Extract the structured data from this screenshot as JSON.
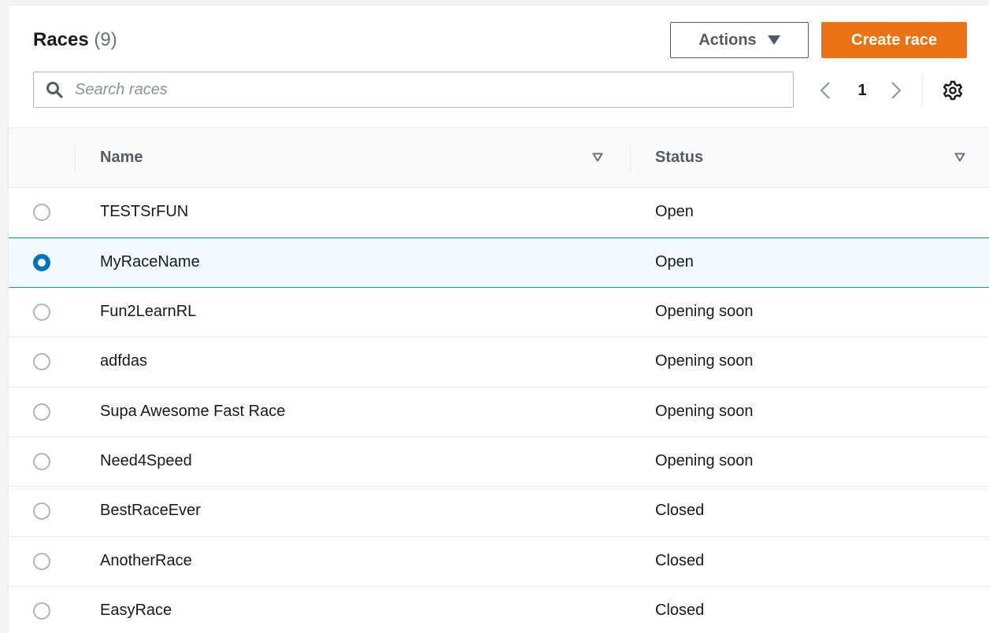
{
  "header": {
    "title": "Races",
    "count": "(9)",
    "actions_label": "Actions",
    "create_label": "Create race"
  },
  "search": {
    "placeholder": "Search races",
    "value": ""
  },
  "pagination": {
    "current_page": "1"
  },
  "table": {
    "columns": [
      "Name",
      "Status"
    ],
    "rows": [
      {
        "name": "TESTSrFUN",
        "status": "Open",
        "selected": false
      },
      {
        "name": "MyRaceName",
        "status": "Open",
        "selected": true
      },
      {
        "name": "Fun2LearnRL",
        "status": "Opening soon",
        "selected": false
      },
      {
        "name": "adfdas",
        "status": "Opening soon",
        "selected": false
      },
      {
        "name": "Supa Awesome Fast Race",
        "status": "Opening soon",
        "selected": false
      },
      {
        "name": "Need4Speed",
        "status": "Opening soon",
        "selected": false
      },
      {
        "name": "BestRaceEver",
        "status": "Closed",
        "selected": false
      },
      {
        "name": "AnotherRace",
        "status": "Closed",
        "selected": false
      },
      {
        "name": "EasyRace",
        "status": "Closed",
        "selected": false
      }
    ]
  },
  "colors": {
    "accent": "#ec7211",
    "selected_border": "#00a1c9",
    "selected_bg": "#f1faff",
    "radio_checked": "#0073bb"
  },
  "icons": {
    "search": "search-icon",
    "actions_caret": "caret-down-icon",
    "prev": "chevron-left-icon",
    "next": "chevron-right-icon",
    "settings": "gear-icon",
    "sort": "sort-caret-icon"
  }
}
